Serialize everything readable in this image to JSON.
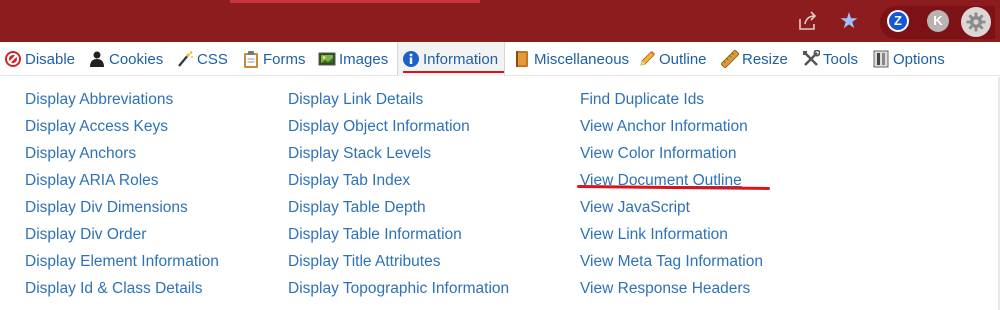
{
  "browser": {
    "icons": [
      "share-icon",
      "star-icon",
      "zotero-icon",
      "profile-avatar-icon",
      "gear-icon"
    ],
    "avatar_z": "Z",
    "avatar_k": "K"
  },
  "tabs": [
    {
      "label": "Disable",
      "icon": "disable-icon"
    },
    {
      "label": "Cookies",
      "icon": "cookies-icon"
    },
    {
      "label": "CSS",
      "icon": "css-wand-icon"
    },
    {
      "label": "Forms",
      "icon": "forms-clipboard-icon"
    },
    {
      "label": "Images",
      "icon": "images-icon"
    },
    {
      "label": "Information",
      "icon": "information-icon",
      "active": true
    },
    {
      "label": "Miscellaneous",
      "icon": "miscellaneous-book-icon"
    },
    {
      "label": "Outline",
      "icon": "outline-pencil-icon"
    },
    {
      "label": "Resize",
      "icon": "resize-ruler-icon"
    },
    {
      "label": "Tools",
      "icon": "tools-icon"
    },
    {
      "label": "Options",
      "icon": "options-icon"
    }
  ],
  "columns": [
    [
      "Display Abbreviations",
      "Display Access Keys",
      "Display Anchors",
      "Display ARIA Roles",
      "Display Div Dimensions",
      "Display Div Order",
      "Display Element Information",
      "Display Id & Class Details"
    ],
    [
      "Display Link Details",
      "Display Object Information",
      "Display Stack Levels",
      "Display Tab Index",
      "Display Table Depth",
      "Display Table Information",
      "Display Title Attributes",
      "Display Topographic Information"
    ],
    [
      "Find Duplicate Ids",
      "View Anchor Information",
      "View Color Information",
      "View Document Outline",
      "View JavaScript",
      "View Link Information",
      "View Meta Tag Information",
      "View Response Headers"
    ]
  ],
  "colors": {
    "toolbar": "#8d1c1f",
    "link": "#2d72b8",
    "annotation": "#d9151b"
  }
}
